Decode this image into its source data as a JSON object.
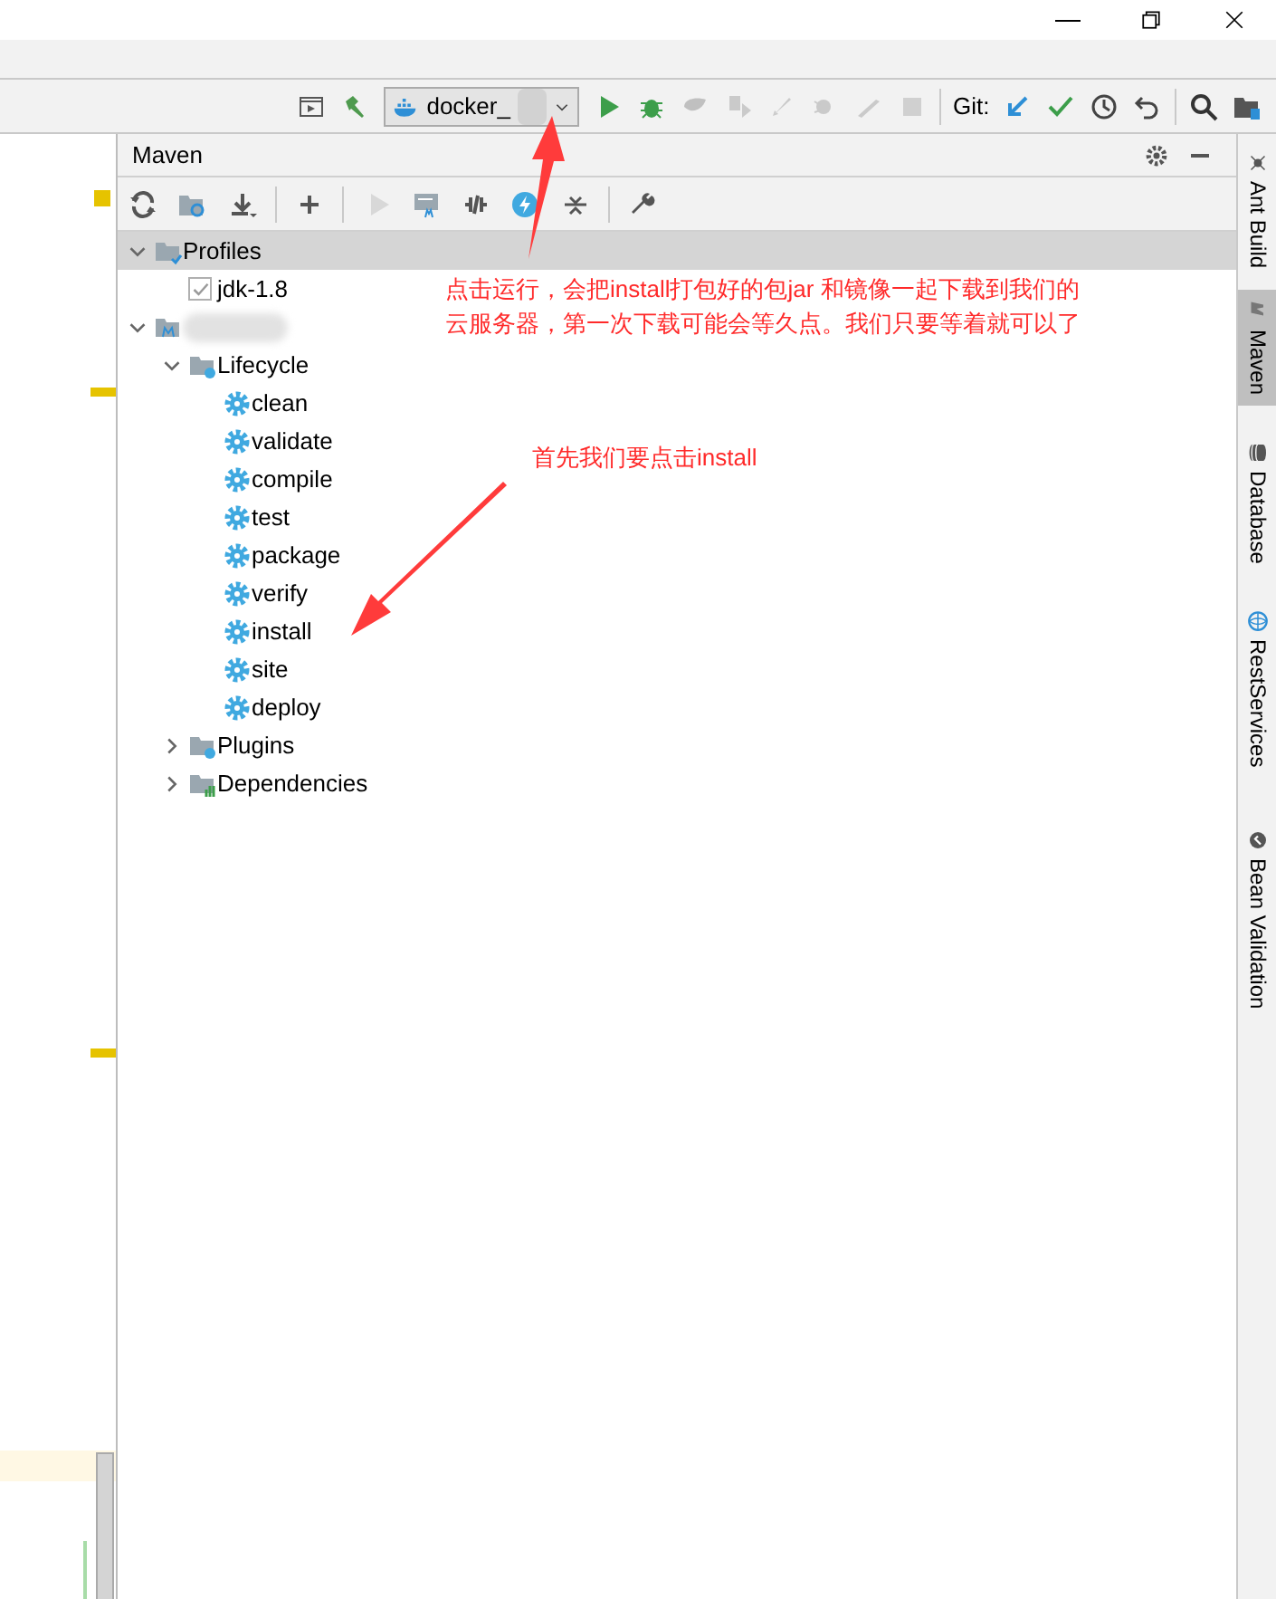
{
  "window_controls": [
    {
      "kind": "minimize"
    },
    {
      "kind": "restore"
    },
    {
      "kind": "close"
    }
  ],
  "main_toolbar": [
    {
      "kind": "button",
      "disabled": false
    },
    {
      "kind": "button",
      "disabled": false
    },
    {
      "kind": "dropdown",
      "label": "docker_"
    },
    {
      "kind": "button",
      "disabled": false
    },
    {
      "kind": "button",
      "disabled": false
    },
    {
      "kind": "button",
      "disabled": true
    },
    {
      "kind": "button",
      "disabled": true
    },
    {
      "kind": "button",
      "disabled": true
    },
    {
      "kind": "button",
      "disabled": true
    },
    {
      "kind": "button",
      "disabled": true
    },
    {
      "kind": "button",
      "disabled": true
    },
    {
      "kind": "separator"
    },
    {
      "kind": "label",
      "label": "Git:"
    },
    {
      "kind": "button",
      "disabled": false
    },
    {
      "kind": "button",
      "disabled": false
    },
    {
      "kind": "button",
      "disabled": false
    },
    {
      "kind": "button",
      "disabled": false
    },
    {
      "kind": "separator"
    },
    {
      "kind": "button",
      "disabled": false
    },
    {
      "kind": "button",
      "disabled": false
    }
  ],
  "maven": {
    "title": "Maven",
    "toolbar": [
      {
        "kind": "button",
        "disabled": false
      },
      {
        "kind": "button",
        "disabled": false
      },
      {
        "kind": "button",
        "disabled": false
      },
      {
        "kind": "separator"
      },
      {
        "kind": "button",
        "disabled": false
      },
      {
        "kind": "separator"
      },
      {
        "kind": "button",
        "disabled": true
      },
      {
        "kind": "button",
        "disabled": false
      },
      {
        "kind": "button",
        "disabled": false
      },
      {
        "kind": "button",
        "disabled": false
      },
      {
        "kind": "button",
        "disabled": false
      },
      {
        "kind": "separator"
      },
      {
        "kind": "button",
        "disabled": false
      }
    ],
    "tree": [
      {
        "kind": "profiles",
        "label": "Profiles",
        "expanded": true,
        "selected": true,
        "children": [
          {
            "kind": "profile",
            "label": "jdk-1.8",
            "checked": true,
            "selected": false
          }
        ]
      },
      {
        "kind": "project",
        "expanded": true,
        "selected": false,
        "children": [
          {
            "kind": "lifecycle",
            "label": "Lifecycle",
            "expanded": true,
            "selected": false,
            "children": [
              {
                "kind": "goal",
                "label": "clean",
                "selected": false
              },
              {
                "kind": "goal",
                "label": "validate",
                "selected": false
              },
              {
                "kind": "goal",
                "label": "compile",
                "selected": false
              },
              {
                "kind": "goal",
                "label": "test",
                "selected": false
              },
              {
                "kind": "goal",
                "label": "package",
                "selected": false
              },
              {
                "kind": "goal",
                "label": "verify",
                "selected": false
              },
              {
                "kind": "goal",
                "label": "install",
                "selected": false
              },
              {
                "kind": "goal",
                "label": "site",
                "selected": false
              },
              {
                "kind": "goal",
                "label": "deploy",
                "selected": false
              }
            ]
          },
          {
            "kind": "plugins",
            "label": "Plugins",
            "expanded": false,
            "selected": false
          },
          {
            "kind": "dependencies",
            "label": "Dependencies",
            "expanded": false,
            "selected": false
          }
        ]
      }
    ]
  },
  "side_tabs": [
    {
      "label": "Ant Build",
      "selected": false
    },
    {
      "label": "Maven",
      "selected": true
    },
    {
      "label": "Database",
      "selected": false
    },
    {
      "label": "RestServices",
      "selected": false
    },
    {
      "label": "Bean Validation",
      "selected": false
    }
  ],
  "annotations": [
    {
      "text": "点击运行，会把install打包好的包jar 和镜像一起下载到我们的云服务器，第一次下载可能会等久点。我们只要等着就可以了"
    },
    {
      "text": "首先我们要点击install"
    }
  ]
}
